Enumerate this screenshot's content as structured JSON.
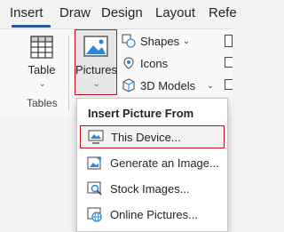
{
  "tabs": [
    "Insert",
    "Draw",
    "Design",
    "Layout",
    "Refe"
  ],
  "ribbon": {
    "table_label": "Table",
    "tables_group_label": "Tables",
    "pictures_label": "Pictures",
    "shapes_label": "Shapes",
    "icons_label": "Icons",
    "models_label": "3D Models"
  },
  "menu": {
    "header": "Insert Picture From",
    "items": [
      "This Device...",
      "Generate an Image...",
      "Stock Images...",
      "Online Pictures..."
    ]
  },
  "colors": {
    "accent": "#2b579a",
    "selection_border": "#c50f1f"
  }
}
